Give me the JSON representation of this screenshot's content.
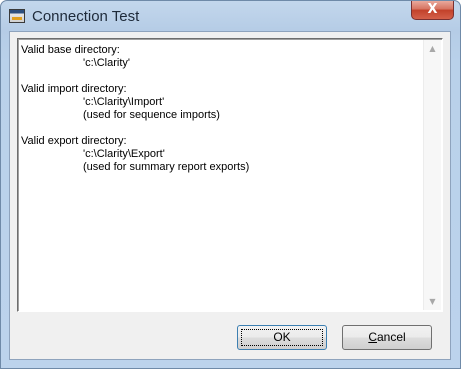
{
  "window": {
    "title": "Connection Test",
    "close_label": "X"
  },
  "log": {
    "lines": [
      {
        "text": "Valid base directory:",
        "indent": false
      },
      {
        "text": "'c:\\Clarity'",
        "indent": true
      },
      {
        "text": "",
        "indent": false
      },
      {
        "text": "Valid import directory:",
        "indent": false
      },
      {
        "text": "'c:\\Clarity\\Import'",
        "indent": true
      },
      {
        "text": "(used for sequence imports)",
        "indent": true
      },
      {
        "text": "",
        "indent": false
      },
      {
        "text": "Valid export directory:",
        "indent": false
      },
      {
        "text": "'c:\\Clarity\\Export'",
        "indent": true
      },
      {
        "text": "(used for summary report exports)",
        "indent": true
      }
    ]
  },
  "scrollbar": {
    "up_icon": "scroll-up-arrow-icon",
    "down_icon": "scroll-down-arrow-icon"
  },
  "buttons": {
    "ok_label": "OK",
    "cancel_first": "C",
    "cancel_rest": "ancel"
  }
}
